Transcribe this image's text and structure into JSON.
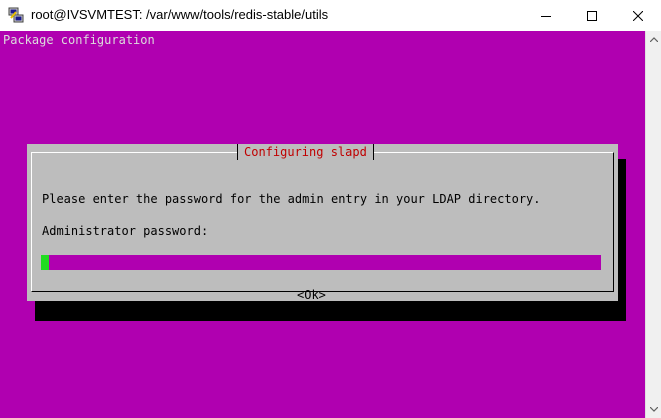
{
  "window": {
    "title": "root@IVSVMTEST: /var/www/tools/redis-stable/utils",
    "icon": "putty-icon",
    "controls": [
      "minimize-icon",
      "maximize-icon",
      "close-icon"
    ]
  },
  "terminal": {
    "header": "Package configuration",
    "background_color": "#b000b0"
  },
  "dialog": {
    "title": "Configuring slapd",
    "title_color": "#c00000",
    "prompt": "Please enter the password for the admin entry in your LDAP directory.",
    "field_label": "Administrator password:",
    "password_value": "",
    "ok_label": "<Ok>",
    "cursor_color": "#22dd22"
  }
}
